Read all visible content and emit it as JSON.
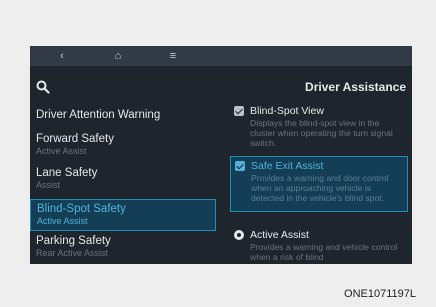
{
  "topbar": {
    "back_icon": "‹",
    "home_icon": "⌂",
    "menu_icon": "≡"
  },
  "sidebar": {
    "items": [
      {
        "title": "Driver Attention Warning",
        "sub": ""
      },
      {
        "title": "Forward Safety",
        "sub": "Active Assist"
      },
      {
        "title": "Lane Safety",
        "sub": "Assist"
      },
      {
        "title": "Blind-Spot Safety",
        "sub": "Active Assist"
      },
      {
        "title": "Parking Safety",
        "sub": "Rear Active Assist"
      }
    ]
  },
  "panel": {
    "title": "Driver Assistance",
    "options": [
      {
        "label": "Blind-Spot View",
        "desc": "Displays the blind-spot view in the cluster when operating the turn signal switch."
      },
      {
        "label": "Safe Exit Assist",
        "desc": "Provides a warning and door control when an approaching vehicle is detected in the vehicle's blind spot."
      },
      {
        "label": "Active Assist",
        "desc": "Provides a warning and vehicle control when a risk of blind"
      }
    ]
  },
  "caption": "ONE1071197L"
}
